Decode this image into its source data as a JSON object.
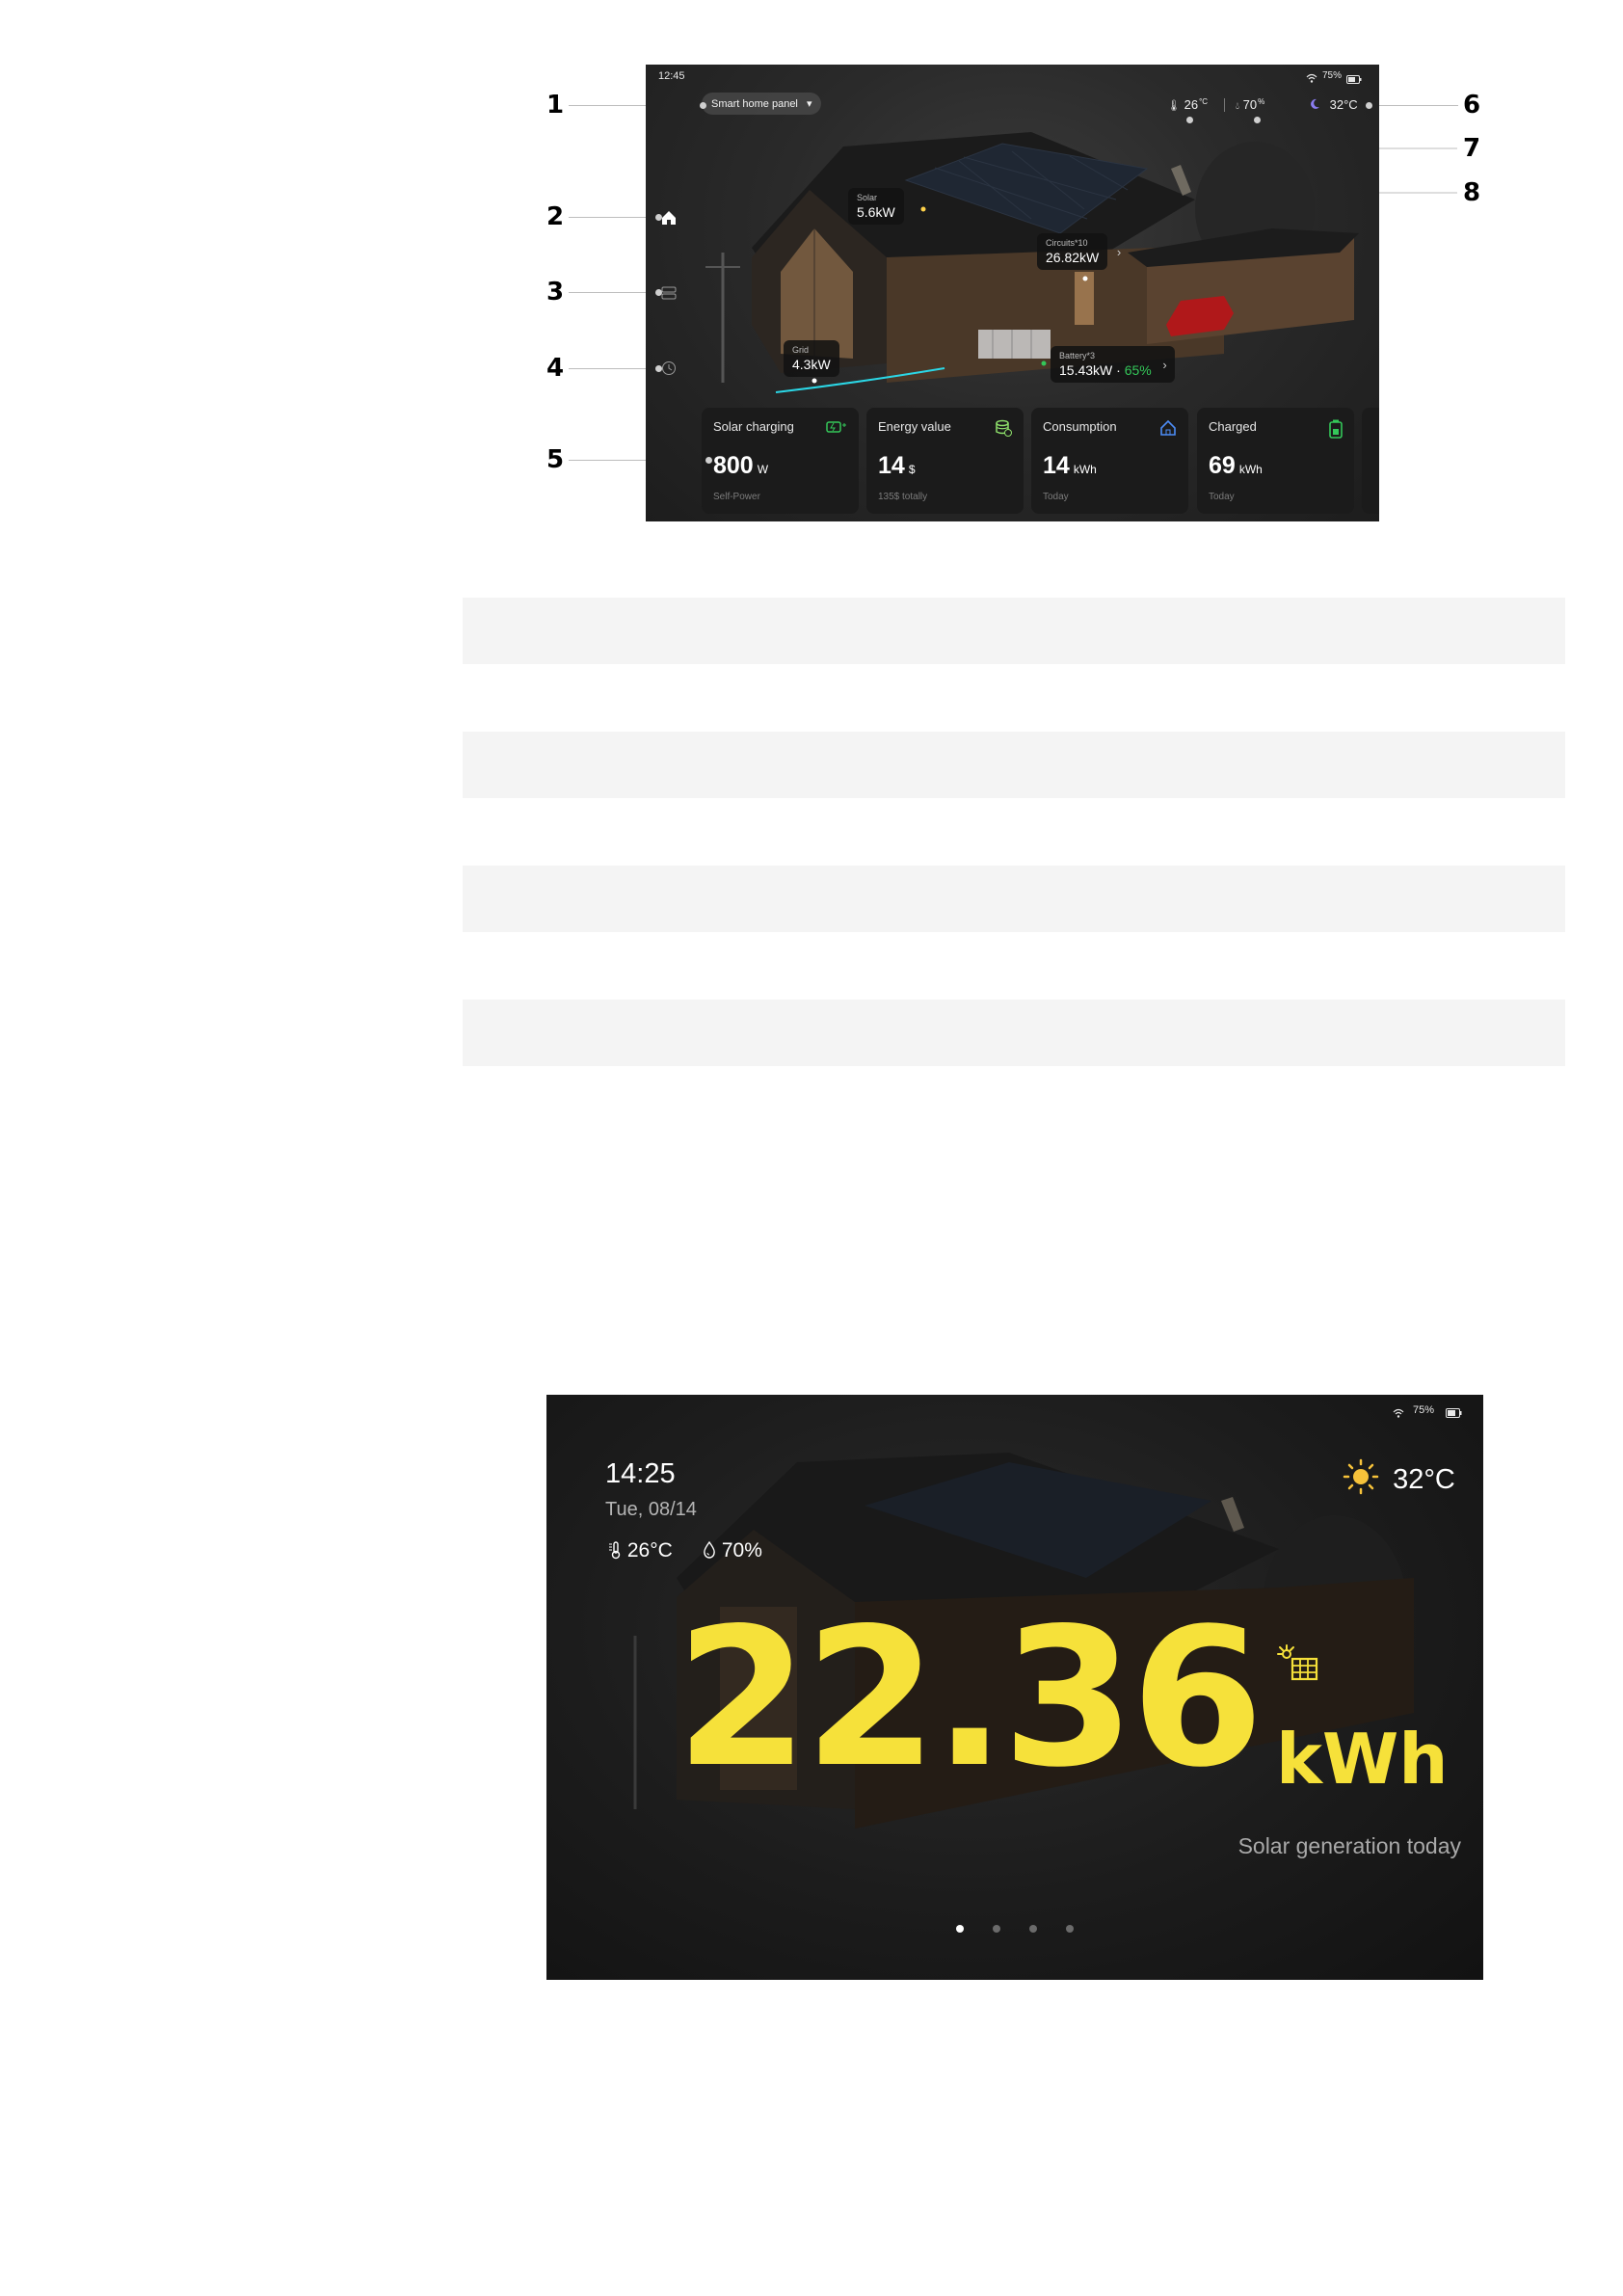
{
  "callouts": [
    "1",
    "2",
    "3",
    "4",
    "5",
    "6",
    "7",
    "8"
  ],
  "screen1": {
    "status": {
      "time": "12:45",
      "battery": "75%"
    },
    "panel_selector": "Smart home panel",
    "weather": {
      "indoor_temp": "26",
      "indoor_unit": "°C",
      "humidity": "70",
      "humidity_unit": "%",
      "outdoor_temp": "32°C"
    },
    "tags": {
      "solar": {
        "label": "Solar",
        "value": "5.6kW"
      },
      "circuits": {
        "label": "Circuits*10",
        "value": "26.82kW"
      },
      "grid": {
        "label": "Grid",
        "value": "4.3kW"
      },
      "battery": {
        "label": "Battery*3",
        "value": "15.43kW ·",
        "percent": "65%"
      }
    },
    "cards": [
      {
        "title": "Solar charging",
        "value": "800",
        "unit": "W",
        "sub": "Self-Power",
        "icon": "solar-charging-icon",
        "icon_color": "#34c759"
      },
      {
        "title": "Energy value",
        "value": "14",
        "unit": "$",
        "sub": "135$ totally",
        "icon": "coins-icon",
        "icon_color": "#8ee06b"
      },
      {
        "title": "Consumption",
        "value": "14",
        "unit": "kWh",
        "sub": "Today",
        "icon": "house-icon",
        "icon_color": "#4d8df7"
      },
      {
        "title": "Charged",
        "value": "69",
        "unit": "kWh",
        "sub": "Today",
        "icon": "battery-icon",
        "icon_color": "#34c759"
      }
    ],
    "accent": "#34c759"
  },
  "screen2": {
    "status": {
      "battery": "75%"
    },
    "time": "14:25",
    "date": "Tue, 08/14",
    "indoor_temp": "26°C",
    "humidity": "70%",
    "outdoor_temp": "32°C",
    "generation_value": "22.36",
    "generation_unit": "kWh",
    "generation_label": "Solar generation today",
    "active_page": 1,
    "page_count": 4,
    "accent": "#f6e13a"
  }
}
